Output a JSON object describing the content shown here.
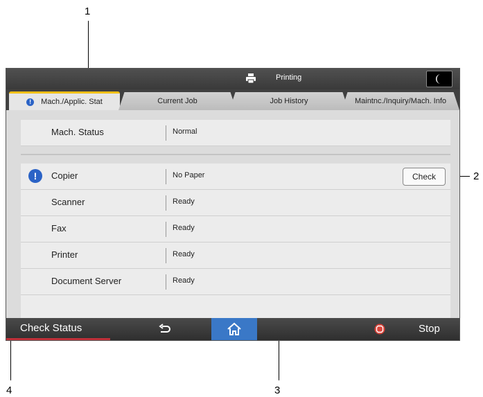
{
  "callouts": [
    "1",
    "2",
    "3",
    "4"
  ],
  "topbar": {
    "status": "Printing",
    "printer_icon": "printer-icon",
    "energy_icon": "moon-icon"
  },
  "tabs": [
    {
      "label": "Mach./Applic. Stat",
      "active": true,
      "icon": "info-icon"
    },
    {
      "label": "Current Job",
      "active": false
    },
    {
      "label": "Job History",
      "active": false
    },
    {
      "label": "Maintnc./Inquiry/Mach. Info",
      "active": false
    }
  ],
  "mach_status": {
    "label": "Mach. Status",
    "value": "Normal"
  },
  "rows": [
    {
      "label": "Copier",
      "value": "No Paper",
      "alert": true,
      "action": "Check"
    },
    {
      "label": "Scanner",
      "value": "Ready"
    },
    {
      "label": "Fax",
      "value": "Ready"
    },
    {
      "label": "Printer",
      "value": "Ready"
    },
    {
      "label": "Document Server",
      "value": "Ready"
    }
  ],
  "alert_symbol": "!",
  "bottombar": {
    "check_status": "Check Status",
    "stop": "Stop",
    "back_icon": "back-arrow-icon",
    "home_icon": "home-icon",
    "stop_icon": "stop-icon"
  },
  "colors": {
    "tab_accent": "#f2c018",
    "info_blue": "#2b63c6",
    "home_blue": "#3a78c7",
    "stop_red": "#d9443a"
  }
}
